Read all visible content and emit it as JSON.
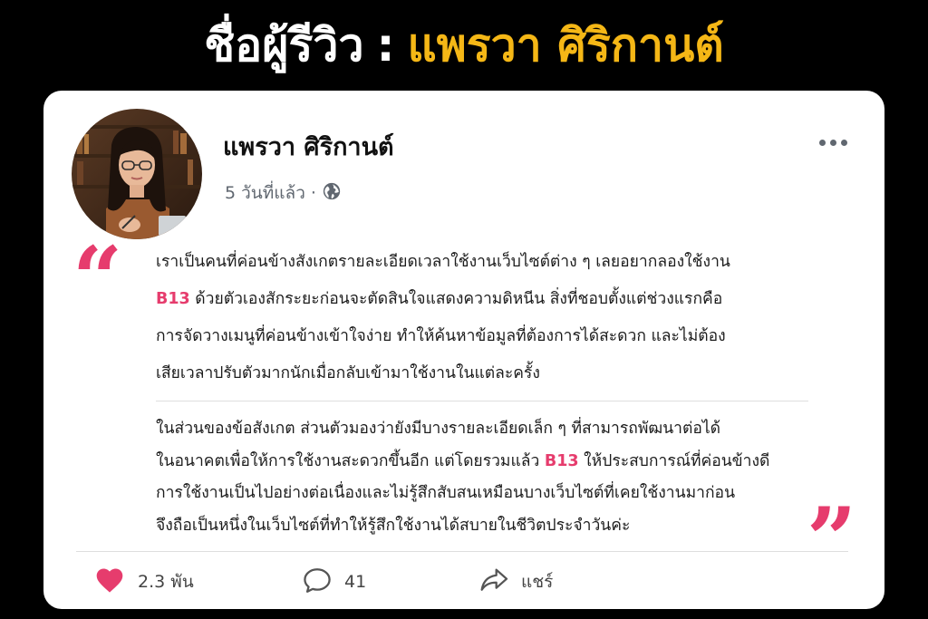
{
  "headline": {
    "label": "ชื่อผู้รีวิว",
    "separator": ":",
    "name": "แพรวา ศิริกานต์"
  },
  "post": {
    "author": "แพรวา ศิริกานต์",
    "time": "5 วันที่แล้ว ·",
    "privacy_icon": "globe-icon",
    "menu_icon": "more-dots-icon",
    "quote_open": "“",
    "quote_close": "”",
    "brand_color": "#e63c6d",
    "accent_color": "#f5b716",
    "paragraph1": {
      "line1": "เราเป็นคนที่ค่อนข้างสังเกตรายละเอียดเวลาใช้งานเว็บไซต์ต่าง ๆ เลยอยากลองใช้งาน",
      "line2_brand": "B13",
      "line2_rest": " ด้วยตัวเองสักระยะก่อนจะตัดสินใจแสดงความดิหนีน สิ่งที่ชอบตั้งแต่ช่วงแรกคือ",
      "line3": "การจัดวางเมนูที่ค่อนข้างเข้าใจง่าย ทำให้ค้นหาข้อมูลที่ต้องการได้สะดวก และไม่ต้อง",
      "line4": "เสียเวลาปรับตัวมากนักเมื่อกลับเข้ามาใช้งานในแต่ละครั้ง"
    },
    "paragraph2": {
      "line1": "ในส่วนของข้อสังเกต ส่วนตัวมองว่ายังมีบางรายละเอียดเล็ก ๆ ที่สามารถพัฒนาต่อได้",
      "line2_start": "ในอนาคตเพื่อให้การใช้งานสะดวกขึ้นอีก แต่โดยรวมแล้ว ",
      "line2_brand": "B13",
      "line2_end": " ให้ประสบการณ์ที่ค่อนข้างดี",
      "line3": "การใช้งานเป็นไปอย่างต่อเนื่องและไม่รู้สึกสับสนเหมือนบางเว็บไซต์ที่เคยใช้งานมาก่อน",
      "line4": "จึงถือเป็นหนึ่งในเว็บไซต์ที่ทำให้รู้สึกใช้งานได้สบายในชีวิตประจำวันค่ะ"
    },
    "actions": {
      "likes": "2.3 พัน",
      "comments": "41",
      "share": "แชร์"
    }
  }
}
